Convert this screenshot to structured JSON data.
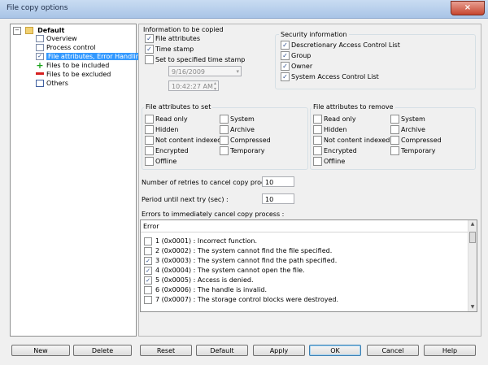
{
  "window": {
    "title": "File copy options",
    "close_glyph": "×"
  },
  "tree": {
    "root": "Default",
    "expander": "−",
    "items": [
      {
        "label": "Overview",
        "icon": "overview-icon"
      },
      {
        "label": "Process control",
        "icon": "process-control-icon"
      },
      {
        "label": "File attributes, Error Handling",
        "icon": "attributes-icon",
        "selected": true
      },
      {
        "label": "Files to be included",
        "icon": "plus-icon"
      },
      {
        "label": "Files to be excluded",
        "icon": "minus-icon"
      },
      {
        "label": "Others",
        "icon": "others-icon"
      }
    ]
  },
  "info": {
    "title": "Information to be copied",
    "file_attributes": "File attributes",
    "time_stamp": "Time stamp",
    "set_time_stamp": "Set to specified time stamp",
    "date_value": "9/16/2009",
    "time_value": "10:42:27 AM"
  },
  "security": {
    "title": "Security information",
    "items": [
      "Descretionary Access Control List",
      "Group",
      "Owner",
      "System Access Control List"
    ]
  },
  "attr_set": {
    "title": "File attributes to set",
    "col1": [
      "Read only",
      "Hidden",
      "Not content indexed",
      "Encrypted",
      "Offline"
    ],
    "col2": [
      "System",
      "Archive",
      "Compressed",
      "Temporary"
    ]
  },
  "attr_remove": {
    "title": "File attributes to remove",
    "col1": [
      "Read only",
      "Hidden",
      "Not content indexed",
      "Encrypted",
      "Offline"
    ],
    "col2": [
      "System",
      "Archive",
      "Compressed",
      "Temporary"
    ]
  },
  "retries": {
    "label": "Number of retries to cancel copy process :",
    "value": "10"
  },
  "period": {
    "label": "Period until next try (sec) :",
    "value": "10"
  },
  "errors": {
    "title": "Errors to immediately cancel copy process :",
    "column": "Error",
    "rows": [
      {
        "text": "1 (0x0001) : Incorrect function.",
        "checked": false
      },
      {
        "text": "2 (0x0002) : The system cannot find the file specified.",
        "checked": false
      },
      {
        "text": "3 (0x0003) : The system cannot find the path specified.",
        "checked": true
      },
      {
        "text": "4 (0x0004) : The system cannot open the file.",
        "checked": true
      },
      {
        "text": "5 (0x0005) : Access is denied.",
        "checked": true
      },
      {
        "text": "6 (0x0006) : The handle is invalid.",
        "checked": false
      },
      {
        "text": "7 (0x0007) : The storage control blocks were destroyed.",
        "checked": false
      }
    ]
  },
  "buttons": {
    "new": "New",
    "delete": "Delete",
    "reset": "Reset",
    "default": "Default",
    "apply": "Apply",
    "ok": "OK",
    "cancel": "Cancel",
    "help": "Help"
  }
}
